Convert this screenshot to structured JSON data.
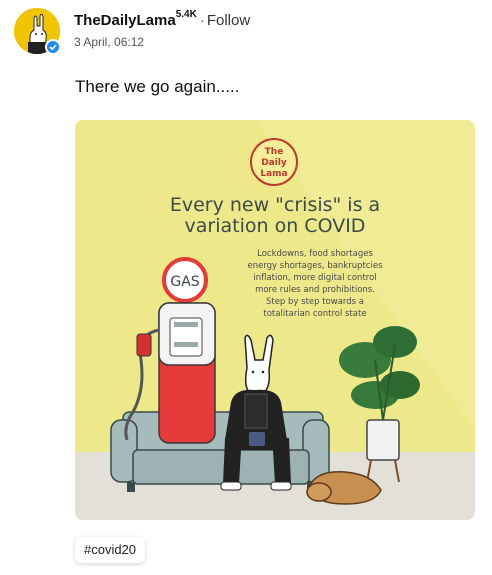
{
  "post": {
    "username": "TheDailyLama",
    "followers": "5.4K",
    "separator": "·",
    "follow_label": "Follow",
    "timestamp": "3 April, 06:12",
    "text": "There we go again....."
  },
  "image": {
    "logo_line1": "The",
    "logo_line2": "Daily",
    "logo_line3": "Lama",
    "headline_line1": "Every new \"crisis\" is a",
    "headline_line2": "variation on COVID",
    "body_lines": [
      "Lockdowns, food shortages",
      "energy shortages, bankruptcies",
      "inflation, more digital control",
      "more rules and prohibitions.",
      "Step by step towards a",
      "totalitarian control state"
    ],
    "pump_sign": "GAS",
    "colors": {
      "background": "#ede98a",
      "floor": "#e3e0d8",
      "sofa": "#a6bcbc",
      "pump_red": "#e63a3a",
      "headline": "#3c4a48",
      "logo_red": "#c0392b"
    }
  },
  "tags": [
    "#covid20"
  ],
  "icons": {
    "verified": "verified-check-icon",
    "avatar": "llama-avatar-icon"
  }
}
